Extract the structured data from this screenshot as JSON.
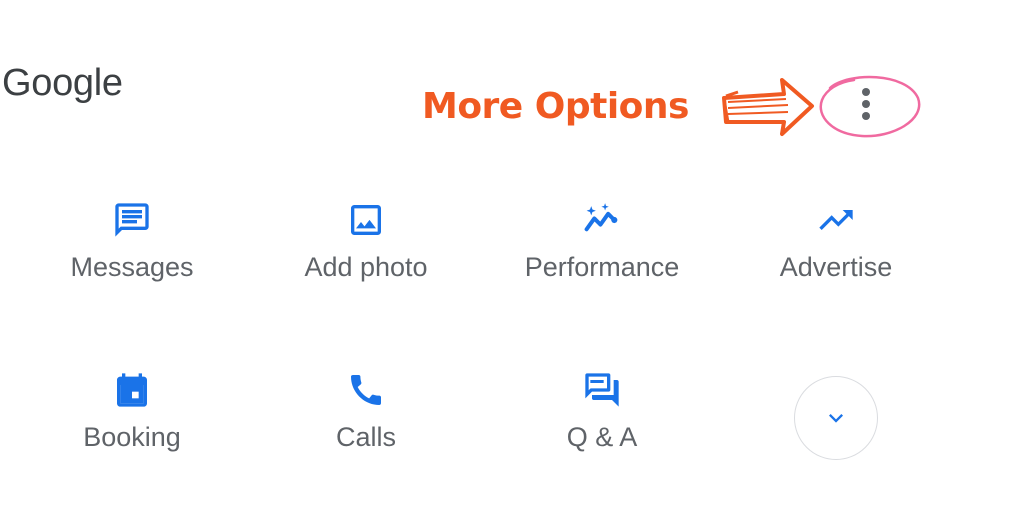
{
  "header": {
    "brand": "Google"
  },
  "annotation": {
    "label": "More Options",
    "color": "#f05a22",
    "highlight_color": "#f06aa0"
  },
  "accent_color": "#1a73e8",
  "actions": [
    {
      "label": "Messages",
      "icon": "message-icon"
    },
    {
      "label": "Add photo",
      "icon": "image-icon"
    },
    {
      "label": "Performance",
      "icon": "sparkle-trend-icon"
    },
    {
      "label": "Advertise",
      "icon": "trending-up-icon"
    },
    {
      "label": "Booking",
      "icon": "calendar-icon"
    },
    {
      "label": "Calls",
      "icon": "phone-icon"
    },
    {
      "label": "Q & A",
      "icon": "forum-icon"
    }
  ],
  "expand": {
    "icon": "chevron-down-icon"
  },
  "more": {
    "icon": "more-vert-icon"
  }
}
